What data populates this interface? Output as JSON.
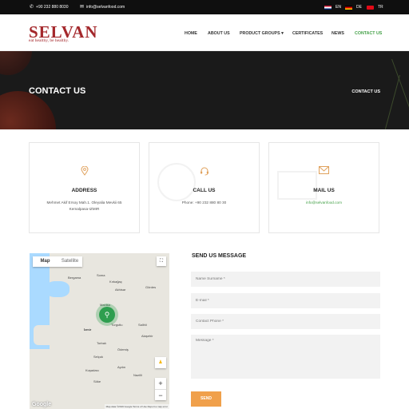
{
  "topbar": {
    "phone": "+90 232 880 8030",
    "email": "info@selvanfood.com",
    "languages": [
      "EN",
      "DE",
      "TR"
    ]
  },
  "header": {
    "logo": "SELVAN",
    "tagline": "eat healthy, be healthy.",
    "nav": [
      "HOME",
      "ABOUT US",
      "PRODUCT GROUPS",
      "CERTIFICATES",
      "NEWS",
      "CONTACT US"
    ],
    "active": "CONTACT US"
  },
  "hero": {
    "title": "CONTACT US",
    "breadcrumb": "CONTACT US"
  },
  "cards": {
    "address": {
      "title": "ADDRESS",
      "line1": "Mehmet Akif Ersoy Mah.1. Oleyalia Mevkii 65",
      "line2": "Kemalpasa-IZMIR"
    },
    "call": {
      "title": "CALL US",
      "text": "Phone: +90 232 880 80 30"
    },
    "mail": {
      "title": "MAIL US",
      "text": "info@selvanfood.com"
    }
  },
  "map": {
    "tabs": [
      "Map",
      "Satellite"
    ],
    "cities": [
      "Bergama",
      "Soma",
      "Kırkağaç",
      "Akhisar",
      "Gördes",
      "Manisa",
      "İzmir",
      "Turgutlu",
      "Salihli",
      "Alaşehir",
      "Torbalı",
      "Ödemiş",
      "Selçuk",
      "Kuşadası",
      "Söke",
      "Aydın",
      "Nazilli"
    ],
    "zoom_in": "+",
    "zoom_out": "−",
    "brand": "Google",
    "footer": "Map data ©2019 Google  Terms of Use  Report a map error"
  },
  "form": {
    "title": "SEND US MESSAGE",
    "name_placeholder": "Name Surname *",
    "email_placeholder": "E-mail *",
    "phone_placeholder": "Contact Phone *",
    "message_placeholder": "Message *",
    "send_label": "SEND"
  },
  "colors": {
    "brand": "#a4282c",
    "accent": "#f0a04b",
    "active": "#43a047"
  }
}
